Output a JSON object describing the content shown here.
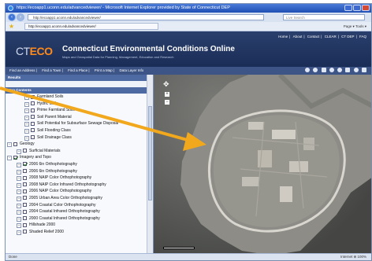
{
  "window": {
    "title": "https://ecoapp1.uconn.edu/advancedviewer/ - Microsoft Internet Explorer provided by State of Connecticut DEP"
  },
  "browser": {
    "address": "http://ecoapp1.uconn.edu/advancedviewer/",
    "search_placeholder": "Live Search",
    "tab_label": "http://ecoapp1.uconn.edu/advancedviewer/",
    "tools": "Page ▾  Tools ▾"
  },
  "app": {
    "logo_ct": "CT",
    "logo_eco": "ECO",
    "title": "Connecticut Environmental Conditions Online",
    "subtitle": "Maps and Geospatial Data for Planning, Management, Education and Research",
    "top_links": [
      "Home",
      "About",
      "Contact",
      "CLEAR",
      "CT DEP",
      "FAQ"
    ]
  },
  "nav": {
    "links": [
      "Find an Address",
      "Find a Town",
      "Find a Place",
      "Print a Map",
      "Data Layer Info"
    ]
  },
  "sidebar": {
    "results_label": "Results",
    "map_contents_label": "Map Contents",
    "tree": [
      {
        "label": "Farmland Soils",
        "level": 3,
        "checked": false
      },
      {
        "label": "Hydric Soils",
        "level": 3,
        "checked": false
      },
      {
        "label": "Prime Farmland Soils",
        "level": 3,
        "checked": false
      },
      {
        "label": "Soil Parent Material",
        "level": 3,
        "checked": false
      },
      {
        "label": "Soil Potential for Subsurface Sewage Disposal",
        "level": 3,
        "checked": false
      },
      {
        "label": "Soil Flooding Class",
        "level": 3,
        "checked": false
      },
      {
        "label": "Soil Drainage Class",
        "level": 3,
        "checked": false
      },
      {
        "label": "Geology",
        "level": 1,
        "checked": false
      },
      {
        "label": "Surficial Materials",
        "level": 2,
        "checked": false
      },
      {
        "label": "Imagery and Topo",
        "level": 1,
        "checked": true
      },
      {
        "label": "2006 6in Orthophotography",
        "level": 2,
        "checked": true
      },
      {
        "label": "2006 6in Orthophotography",
        "level": 2,
        "checked": false
      },
      {
        "label": "2008 NAIP Color Orthophotography",
        "level": 2,
        "checked": false
      },
      {
        "label": "2008 NAIP Color Infrared Orthophotography",
        "level": 2,
        "checked": false
      },
      {
        "label": "2006 NAIP Color Orthophotography",
        "level": 2,
        "checked": false
      },
      {
        "label": "2005 Urban Area Color Orthophotography",
        "level": 2,
        "checked": false
      },
      {
        "label": "2004 Coastal Color Orthophotography",
        "level": 2,
        "checked": false
      },
      {
        "label": "2004 Coastal Infrared Orthophotography",
        "level": 2,
        "checked": false
      },
      {
        "label": "2000 Coastal Infrared Orthophotography",
        "level": 2,
        "checked": false
      },
      {
        "label": "Hillshade 2000",
        "level": 2,
        "checked": false
      },
      {
        "label": "Shaded Relief 2000",
        "level": 2,
        "checked": false
      }
    ]
  },
  "status": {
    "left": "Done",
    "right": "Internet    ⊕ 100%"
  },
  "colors": {
    "annotation_arrow": "#f2a81d",
    "header_bg": "#1f3460",
    "eco_orange": "#ff8a1a"
  }
}
